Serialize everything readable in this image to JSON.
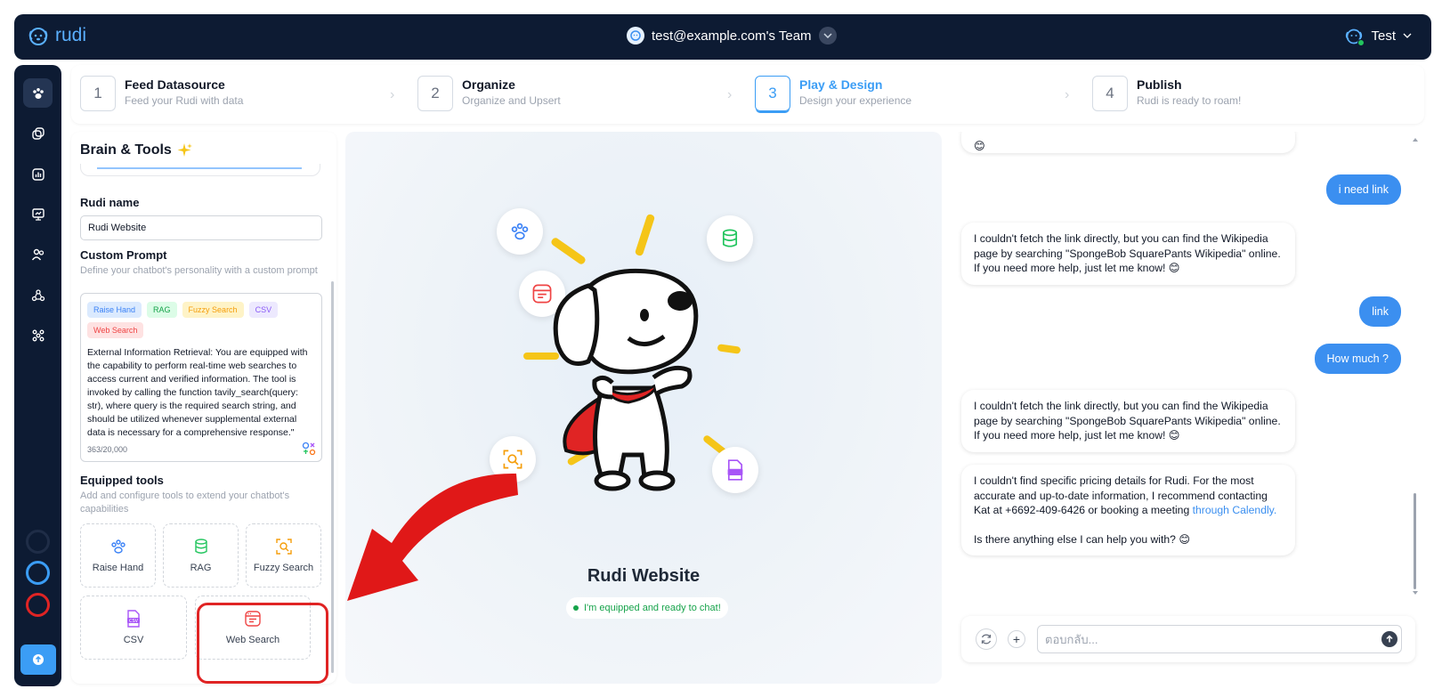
{
  "app": {
    "name": "rudi",
    "brand_color": "#5ab0ff",
    "topbar_color": "#0d1b33"
  },
  "header": {
    "team": "test@example.com's Team",
    "user": "Test"
  },
  "steps": [
    {
      "num": "1",
      "title": "Feed Datasource",
      "subtitle": "Feed your Rudi with data"
    },
    {
      "num": "2",
      "title": "Organize",
      "subtitle": "Organize and Upsert"
    },
    {
      "num": "3",
      "title": "Play & Design",
      "subtitle": "Design your experience",
      "active": true
    },
    {
      "num": "4",
      "title": "Publish",
      "subtitle": "Rudi is ready to roam!"
    }
  ],
  "brain": {
    "title": "Brain & Tools",
    "name_label": "Rudi name",
    "name_value": "Rudi Website",
    "prompt_label": "Custom Prompt",
    "prompt_hint": "Define your chatbot's personality with a custom prompt",
    "tags": [
      "Raise Hand",
      "RAG",
      "Fuzzy Search",
      "CSV",
      "Web Search"
    ],
    "prompt_text": "External Information Retrieval: You are equipped with the capability to perform real-time web searches to access current and verified information. The tool is invoked by calling the function tavily_search(query: str), where query is the required search string, and should be utilized whenever supplemental external data is necessary for a comprehensive response.\"",
    "count": "363/20,000",
    "tools_label": "Equipped tools",
    "tools_hint": "Add and configure tools to extend your chatbot's capabilities",
    "tools": [
      "Raise Hand",
      "RAG",
      "Fuzzy Search",
      "CSV",
      "Web Search"
    ]
  },
  "center": {
    "bot_name": "Rudi Website",
    "status": "I'm equipped and ready to chat!"
  },
  "chat": {
    "m0_emoji": "😊",
    "u1": "i need link",
    "b1": "I couldn't fetch the link directly, but you can find the Wikipedia page by searching \"SpongeBob SquarePants Wikipedia\" online. If you need more help, just let me know! 😊",
    "u2": "link",
    "u3": "How much ?",
    "b2": "I couldn't fetch the link directly, but you can find the Wikipedia page by searching \"SpongeBob SquarePants Wikipedia\" online. If you need more help, just let me know! 😊",
    "b3_part1": "I couldn't find specific pricing details for Rudi. For the most accurate and up-to-date information, I recommend contacting Kat at +6692-409-6426 or booking a meeting ",
    "b3_link": "through Calendly.",
    "b3_part2": "Is there anything else I can help you with? 😊",
    "placeholder": "ตอบกลับ..."
  }
}
